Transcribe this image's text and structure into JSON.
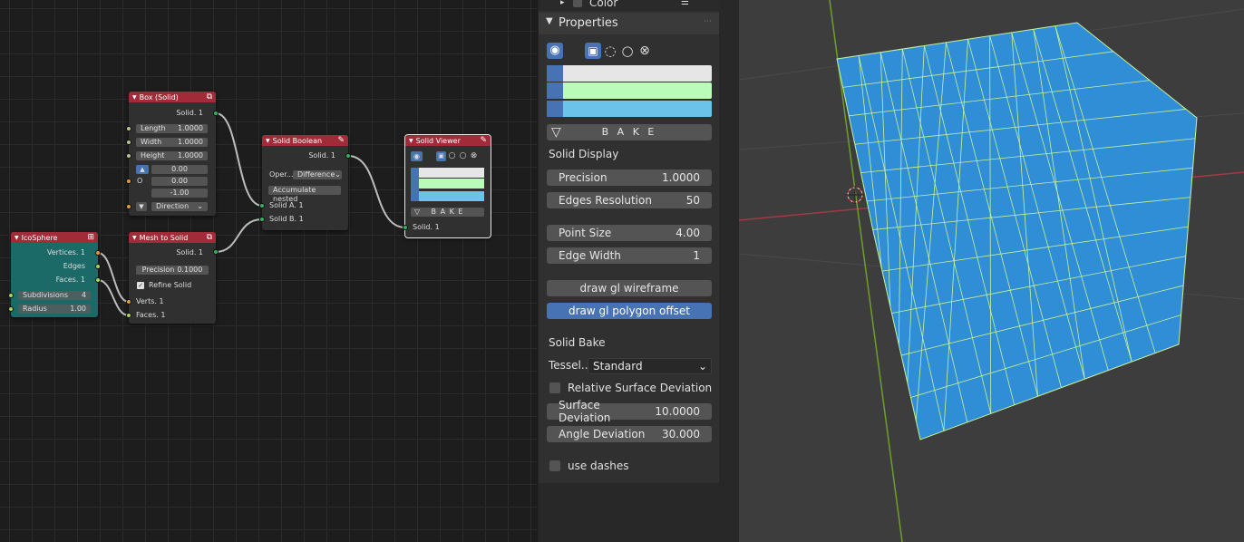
{
  "node_editor": {
    "nodes": {
      "box": {
        "title": "Box (Solid)",
        "output": "Solid. 1",
        "length_label": "Length",
        "length_value": "1.0000",
        "width_label": "Width",
        "width_value": "1.0000",
        "height_label": "Height",
        "height_value": "1.0000",
        "vec_x": "0.00",
        "vec_y": "0.00",
        "vec_z": "-1.00",
        "o_label": "O",
        "direction": "Direction"
      },
      "icosphere": {
        "title": "IcoSphere",
        "out_vertices": "Vertices. 1",
        "out_edges": "Edges",
        "out_faces": "Faces. 1",
        "subdiv_label": "Subdivisions",
        "subdiv_value": "4",
        "radius_label": "Radius",
        "radius_value": "1.00"
      },
      "mesh_to_solid": {
        "title": "Mesh to Solid",
        "output": "Solid. 1",
        "precision_label": "Precision",
        "precision_value": "0.1000",
        "refine_label": "Refine Solid",
        "in_verts": "Verts. 1",
        "in_faces": "Faces. 1"
      },
      "solid_boolean": {
        "title": "Solid Boolean",
        "output": "Solid. 1",
        "oper_label": "Oper...",
        "oper_value": "Difference",
        "accumulate": "Accumulate nested",
        "in_a": "Solid A. 1",
        "in_b": "Solid B. 1"
      },
      "solid_viewer": {
        "title": "Solid Viewer",
        "bake": "B A K E",
        "in_solid": "Solid. 1"
      }
    }
  },
  "panel": {
    "top_label": "Color",
    "properties_title": "Properties",
    "bake": "B A K E",
    "solid_display": "Solid Display",
    "precision_label": "Precision",
    "precision_value": "1.0000",
    "edges_res_label": "Edges Resolution",
    "edges_res_value": "50",
    "point_size_label": "Point Size",
    "point_size_value": "4.00",
    "edge_width_label": "Edge Width",
    "edge_width_value": "1",
    "wireframe_btn": "draw gl wireframe",
    "polygon_offset_btn": "draw gl polygon offset",
    "solid_bake": "Solid Bake",
    "tessel_label": "Tessel...",
    "tessel_value": "Standard",
    "relative_dev_label": "Relative Surface Deviation",
    "surface_dev_label": "Surface Deviation",
    "surface_dev_value": "10.0000",
    "angle_dev_label": "Angle Deviation",
    "angle_dev_value": "30.000",
    "use_dashes_label": "use dashes"
  },
  "colors": {
    "vertex_color": "#e6e6e6",
    "edge_color": "#bafbb9",
    "face_color": "#6bc3ea",
    "accent": "#4772b3",
    "node_header_red": "#a12b38",
    "node_header_teal": "#1c6a67",
    "mesh_fill": "#2f8ed6",
    "wire": "#c8f29a"
  }
}
